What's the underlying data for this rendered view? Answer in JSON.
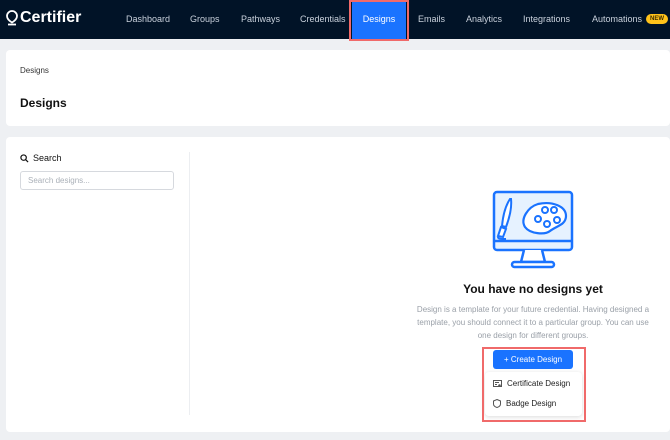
{
  "nav": {
    "logo": "Certifier",
    "items": [
      {
        "label": "Dashboard"
      },
      {
        "label": "Groups"
      },
      {
        "label": "Pathways"
      },
      {
        "label": "Credentials"
      },
      {
        "label": "Designs",
        "active": true
      },
      {
        "label": "Emails"
      },
      {
        "label": "Analytics"
      },
      {
        "label": "Integrations"
      },
      {
        "label": "Automations",
        "badge": "NEW"
      }
    ]
  },
  "header": {
    "breadcrumb": "Designs",
    "title": "Designs"
  },
  "sidebar": {
    "search_label": "Search",
    "search_placeholder": "Search designs...",
    "search_value": ""
  },
  "empty": {
    "title": "You have no designs yet",
    "description": "Design is a template for your future credential. Having designed a template, you should connect it to a particular group. You can use one design for different groups.",
    "icon": "monitor-palette-icon"
  },
  "create": {
    "label": "+ Create Design",
    "menu": [
      {
        "label": "Certificate Design",
        "icon": "certificate-icon"
      },
      {
        "label": "Badge Design",
        "icon": "badge-icon"
      }
    ]
  },
  "colors": {
    "nav_bg": "#011327",
    "accent": "#1a73ff",
    "highlight": "#f06a6a",
    "badge": "#ffc21a"
  }
}
